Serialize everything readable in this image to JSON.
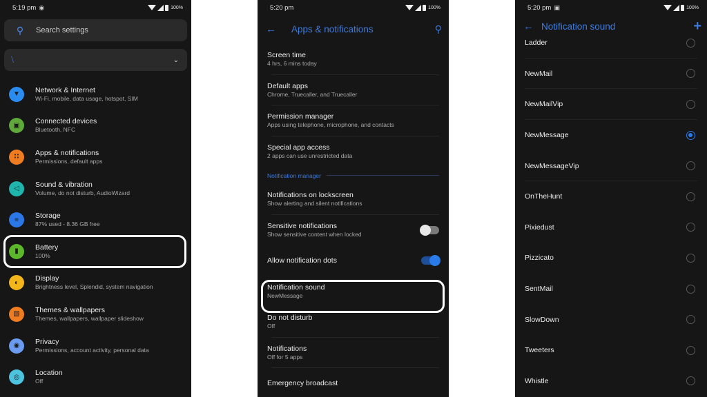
{
  "panel1": {
    "status": {
      "time": "5:19 pm",
      "indicator_icon": "incognito-icon",
      "battery": "100%"
    },
    "search": {
      "placeholder": "Search settings"
    },
    "conditional": {
      "icon": "do-not-disturb-slash-icon",
      "chevron": "chevron-down-icon"
    },
    "items": [
      {
        "title": "Network & Internet",
        "subtitle": "Wi-Fi, mobile, data usage, hotspot, SIM",
        "icon": "wifi-icon",
        "color": "#2b8cef"
      },
      {
        "title": "Connected devices",
        "subtitle": "Bluetooth, NFC",
        "icon": "devices-icon",
        "color": "#5fa83a"
      },
      {
        "title": "Apps & notifications",
        "subtitle": "Permissions, default apps",
        "icon": "apps-grid-icon",
        "color": "#f07c22"
      },
      {
        "title": "Sound & vibration",
        "subtitle": "Volume, do not disturb, AudioWizard",
        "icon": "volume-icon",
        "color": "#1fb5ac"
      },
      {
        "title": "Storage",
        "subtitle": "87% used - 8.36 GB free",
        "icon": "storage-icon",
        "color": "#2b77e6"
      },
      {
        "title": "Battery",
        "subtitle": "100%",
        "icon": "battery-icon",
        "color": "#5cb82a"
      },
      {
        "title": "Display",
        "subtitle": "Brightness level, Splendid, system navigation",
        "icon": "brightness-icon",
        "color": "#f2b51a"
      },
      {
        "title": "Themes & wallpapers",
        "subtitle": "Themes, wallpapers, wallpaper slideshow",
        "icon": "wallpaper-icon",
        "color": "#f07c22"
      },
      {
        "title": "Privacy",
        "subtitle": "Permissions, account activity, personal data",
        "icon": "privacy-eye-icon",
        "color": "#6b9bf0"
      },
      {
        "title": "Location",
        "subtitle": "Off",
        "icon": "location-pin-icon",
        "color": "#4cc4e0"
      }
    ]
  },
  "panel2": {
    "status": {
      "time": "5:20 pm",
      "battery": "100%"
    },
    "title": "Apps & notifications",
    "items_top": [
      {
        "title": "Screen time",
        "subtitle": "4 hrs, 6 mins today"
      },
      {
        "title": "Default apps",
        "subtitle": "Chrome, Truecaller, and Truecaller"
      },
      {
        "title": "Permission manager",
        "subtitle": "Apps using telephone, microphone, and contacts"
      },
      {
        "title": "Special app access",
        "subtitle": "2 apps can use unrestricted data"
      }
    ],
    "section": "Notification manager",
    "items_bottom": [
      {
        "title": "Notifications on lockscreen",
        "subtitle": "Show alerting and silent notifications"
      },
      {
        "title": "Sensitive notifications",
        "subtitle": "Show sensitive content when locked",
        "toggle": "off"
      },
      {
        "title": "Allow notification dots",
        "subtitle": "",
        "toggle": "on"
      },
      {
        "title": "Notification sound",
        "subtitle": "NewMessage"
      },
      {
        "title": "Do not disturb",
        "subtitle": "Off"
      },
      {
        "title": "Notifications",
        "subtitle": "Off for 5 apps"
      },
      {
        "title": "Emergency broadcast",
        "subtitle": ""
      }
    ]
  },
  "panel3": {
    "status": {
      "time": "5:20 pm",
      "indicator_icon": "image-icon",
      "battery": "100%"
    },
    "title": "Notification sound",
    "selected": "NewMessage",
    "sounds": [
      "Ladder",
      "NewMail",
      "NewMailVip",
      "NewMessage",
      "NewMessageVip",
      "OnTheHunt",
      "Pixiedust",
      "Pizzicato",
      "SentMail",
      "SlowDown",
      "Tweeters",
      "Whistle"
    ]
  }
}
